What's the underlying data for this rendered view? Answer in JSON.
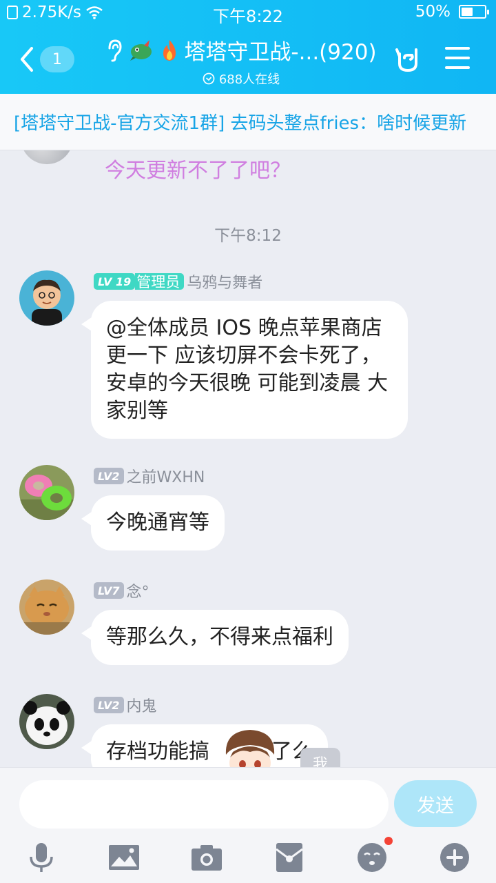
{
  "status_bar": {
    "speed": "2.75K/s",
    "time": "下午8:22",
    "battery": "50%",
    "battery_level": 0.5
  },
  "header": {
    "back_count": "1",
    "group_title": "塔塔守卫战-...(920)",
    "online": "688人在线",
    "icons": [
      "back-arrow",
      "ear-icon",
      "dragon-emoji",
      "fire-emoji",
      "hand-icon",
      "menu-icon"
    ]
  },
  "notice": {
    "text": "[塔塔守卫战-官方交流1群] 去码头整点fries：啥时候更新"
  },
  "chat": {
    "partial_message": "今天更新不了了吧？",
    "time_separator": "下午8:12",
    "messages": [
      {
        "level": "LV 19",
        "role": "管理员",
        "nick": "乌鸦与舞者",
        "text": "@全体成员  IOS 晚点苹果商店更一下 应该切屏不会卡死了，安卓的今天很晚 可能到凌晨 大家别等"
      },
      {
        "level": "LV2",
        "nick": "之前WXHN",
        "text": "今晚通宵等"
      },
      {
        "level": "LV7",
        "nick": "念°",
        "text": "等那么久，不得来点福利"
      },
      {
        "level": "LV2",
        "nick": "内鬼",
        "text": "存档功能搞　　　了么"
      }
    ],
    "me_tag": "我"
  },
  "input_bar": {
    "placeholder": "",
    "send_label": "发送",
    "tools": [
      "mic-icon",
      "image-icon",
      "camera-icon",
      "red-packet-icon",
      "emoji-icon",
      "plus-icon"
    ]
  },
  "colors": {
    "header": "#10b6f4",
    "notice_text": "#17a4e6",
    "admin_badge": "#3fd8c4",
    "send_button": "#aee6f9"
  }
}
